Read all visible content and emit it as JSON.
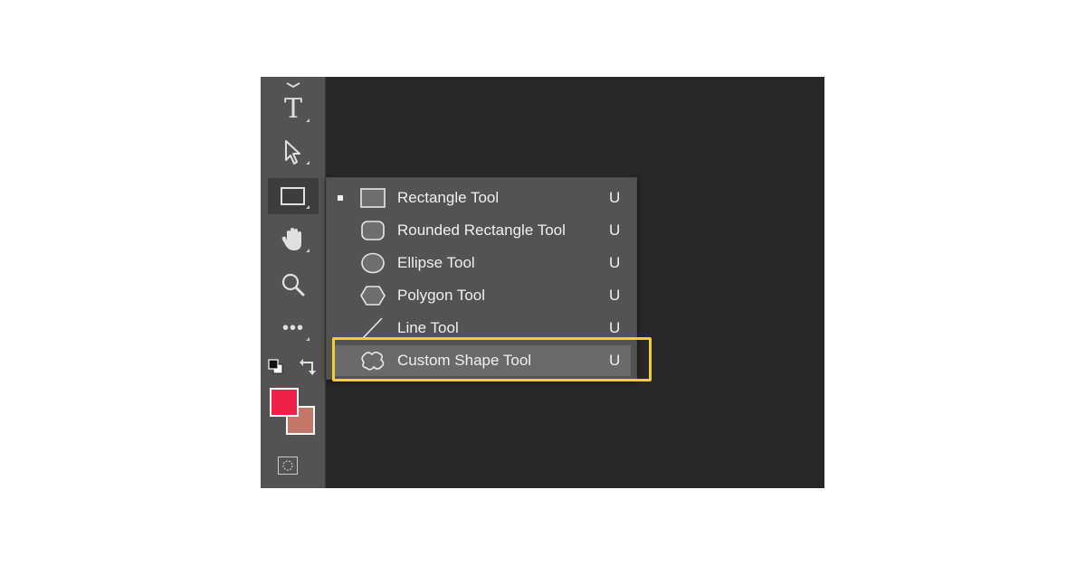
{
  "toolbar": {
    "items": [
      {
        "name": "type-tool",
        "glyph": "T",
        "icon": "type-icon"
      },
      {
        "name": "path-selection-tool",
        "icon": "direct-select-arrow-icon"
      },
      {
        "name": "rectangle-tool",
        "icon": "rectangle-icon",
        "active": true
      },
      {
        "name": "hand-tool",
        "icon": "hand-icon"
      },
      {
        "name": "zoom-tool",
        "icon": "zoom-magnifier-icon"
      },
      {
        "name": "edit-toolbar",
        "glyph": "•••",
        "icon": "more-dots-icon"
      }
    ],
    "default_colors_icon": "default-colors-icon",
    "swap_colors_icon": "swap-colors-icon",
    "foreground_color": "#ed2149",
    "background_color": "#c47669",
    "quick_mask_icon": "quick-mask-icon"
  },
  "flyout": {
    "items": [
      {
        "label": "Rectangle Tool",
        "shortcut": "U",
        "icon": "rectangle-icon",
        "selected": true
      },
      {
        "label": "Rounded Rectangle Tool",
        "shortcut": "U",
        "icon": "rounded-rectangle-icon"
      },
      {
        "label": "Ellipse Tool",
        "shortcut": "U",
        "icon": "ellipse-icon"
      },
      {
        "label": "Polygon Tool",
        "shortcut": "U",
        "icon": "polygon-icon"
      },
      {
        "label": "Line Tool",
        "shortcut": "U",
        "icon": "line-icon"
      },
      {
        "label": "Custom Shape Tool",
        "shortcut": "U",
        "icon": "custom-shape-icon",
        "highlighted": true
      }
    ]
  },
  "colors": {
    "panel": "#535353",
    "canvas": "#282828",
    "highlight_box": "#f2cf2e"
  }
}
